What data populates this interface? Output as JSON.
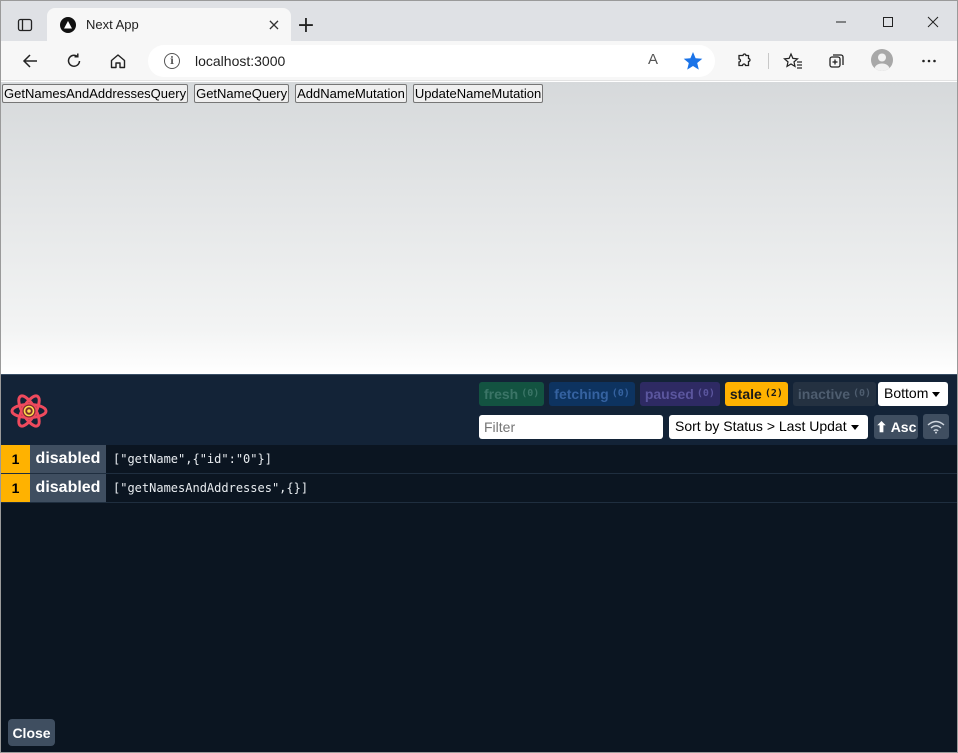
{
  "browser": {
    "tab": {
      "title": "Next App",
      "close_glyph": "×"
    },
    "new_tab_glyph": "+",
    "address": {
      "url": "localhost:3000",
      "read_aloud_glyph": "A"
    }
  },
  "page": {
    "buttons": [
      {
        "label": "GetNamesAndAddressesQuery"
      },
      {
        "label": "GetNameQuery"
      },
      {
        "label": "AddNameMutation"
      },
      {
        "label": "UpdateNameMutation"
      }
    ]
  },
  "devtools": {
    "badges": [
      {
        "label": "fresh",
        "count": "(0)"
      },
      {
        "label": "fetching",
        "count": "(0)"
      },
      {
        "label": "paused",
        "count": "(0)"
      },
      {
        "label": "stale",
        "count": "(2)"
      },
      {
        "label": "inactive",
        "count": "(0)"
      }
    ],
    "position_select": "Bottom",
    "filter_placeholder": "Filter",
    "sort_select": "Sort by Status > Last Updat",
    "asc_label": "⬆ Asc",
    "queries": [
      {
        "count": "1",
        "status": "disabled",
        "key": "[\"getName\",{\"id\":\"0\"}]"
      },
      {
        "count": "1",
        "status": "disabled",
        "key": "[\"getNamesAndAddresses\",{}]"
      }
    ],
    "close_label": "Close"
  },
  "colors": {
    "stale": "#ffb200",
    "panel_bg": "#0b1521",
    "header_bg": "#132337",
    "button_bg": "#3f4e60",
    "favorite_star": "#1a73e8"
  }
}
